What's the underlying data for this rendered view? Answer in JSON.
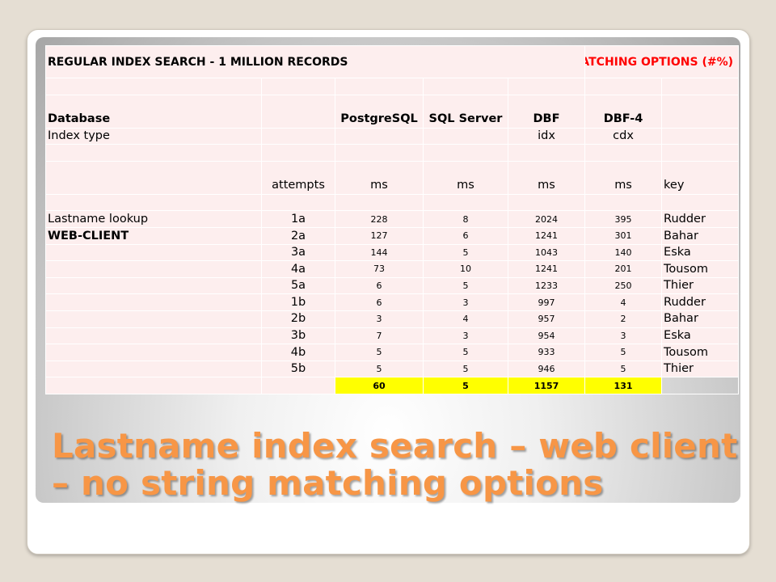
{
  "table": {
    "title_left": "REGULAR INDEX SEARCH - 1 MILLION RECORDS",
    "title_right": "WITHOUT STRING MATCHING OPTIONS (#%)",
    "db_label": "Database",
    "databases": [
      "PostgreSQL",
      "SQL Server",
      "DBF",
      "DBF-4"
    ],
    "index_type_label": "Index type",
    "index_types": [
      "",
      "",
      "idx",
      "cdx"
    ],
    "attempts_header": "attempts",
    "unit_headers": [
      "ms",
      "ms",
      "ms",
      "ms"
    ],
    "key_header": "key",
    "rows": [
      {
        "label": "Lastname lookup",
        "attempt": "1a",
        "values": [
          "228",
          "8",
          "2024",
          "395"
        ],
        "key": "Rudder"
      },
      {
        "label": "WEB-CLIENT",
        "attempt": "2a",
        "values": [
          "127",
          "6",
          "1241",
          "301"
        ],
        "key": "Bahar"
      },
      {
        "label": "",
        "attempt": "3a",
        "values": [
          "144",
          "5",
          "1043",
          "140"
        ],
        "key": "Eska"
      },
      {
        "label": "",
        "attempt": "4a",
        "values": [
          "73",
          "10",
          "1241",
          "201"
        ],
        "key": "Tousom"
      },
      {
        "label": "",
        "attempt": "5a",
        "values": [
          "6",
          "5",
          "1233",
          "250"
        ],
        "key": "Thier"
      },
      {
        "label": "",
        "attempt": "1b",
        "values": [
          "6",
          "3",
          "997",
          "4"
        ],
        "key": "Rudder"
      },
      {
        "label": "",
        "attempt": "2b",
        "values": [
          "3",
          "4",
          "957",
          "2"
        ],
        "key": "Bahar"
      },
      {
        "label": "",
        "attempt": "3b",
        "values": [
          "7",
          "3",
          "954",
          "3"
        ],
        "key": "Eska"
      },
      {
        "label": "",
        "attempt": "4b",
        "values": [
          "5",
          "5",
          "933",
          "5"
        ],
        "key": "Tousom"
      },
      {
        "label": "",
        "attempt": "5b",
        "values": [
          "5",
          "5",
          "946",
          "5"
        ],
        "key": "Thier"
      }
    ],
    "totals": [
      "60",
      "5",
      "1157",
      "131"
    ],
    "colors": {
      "cell_bg": "#fdeeee",
      "highlight": "#ffff00",
      "title_red": "#ff0000"
    }
  },
  "slide": {
    "title": "Lastname index search – web client – no string matching options",
    "title_color": "#f79646"
  }
}
